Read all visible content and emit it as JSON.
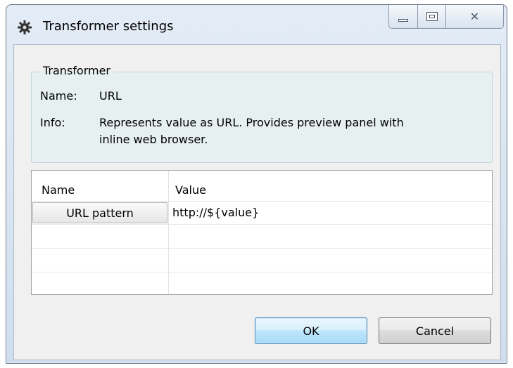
{
  "window": {
    "title": "Transformer settings",
    "icon": "gear-icon",
    "controls": {
      "minimize": "minimize-icon",
      "maximize": "maximize-icon",
      "close_glyph": "✕"
    }
  },
  "transformer_group": {
    "legend": "Transformer",
    "name_label": "Name:",
    "name_value": "URL",
    "info_label": "Info:",
    "info_line1": "Represents value as URL. Provides preview panel with",
    "info_line2": "inline web browser."
  },
  "properties_table": {
    "columns": [
      "Name",
      "Value"
    ],
    "rows": [
      {
        "name": "URL pattern",
        "value": "http://${value}"
      }
    ]
  },
  "buttons": {
    "ok_label": "OK",
    "cancel_label": "Cancel"
  },
  "colors": {
    "accent_border": "#3c7fb1",
    "group_bg": "#e7f0f1"
  }
}
